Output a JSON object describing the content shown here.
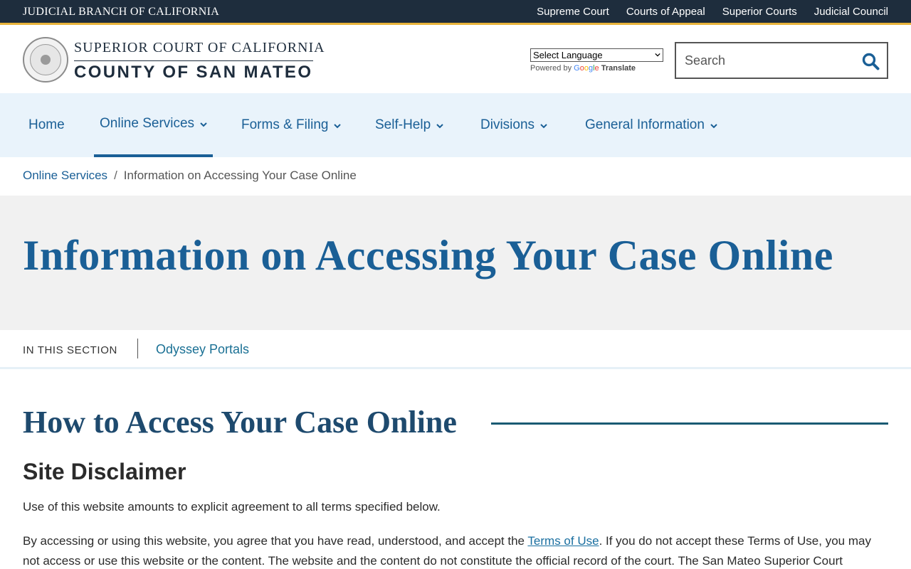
{
  "util_bar": {
    "brand": "JUDICIAL BRANCH OF CALIFORNIA",
    "links": [
      "Supreme Court",
      "Courts of Appeal",
      "Superior Courts",
      "Judicial Council"
    ]
  },
  "header": {
    "logo_line1": "SUPERIOR COURT OF CALIFORNIA",
    "logo_line2": "COUNTY OF SAN MATEO",
    "language_select": "Select Language",
    "powered_by": "Powered by",
    "google": [
      "G",
      "o",
      "o",
      "g",
      "l",
      "e"
    ],
    "translate": "Translate",
    "search_placeholder": "Search"
  },
  "nav": {
    "items": [
      {
        "label": "Home"
      },
      {
        "label": "Online Services"
      },
      {
        "label": "Forms & Filing"
      },
      {
        "label": "Self-Help"
      },
      {
        "label": "Divisions"
      },
      {
        "label": "General Information"
      }
    ]
  },
  "breadcrumb": {
    "parent": "Online Services",
    "separator": "/",
    "current": "Information on Accessing Your Case Online"
  },
  "hero": {
    "title": "Information on Accessing Your Case Online"
  },
  "section": {
    "label": "IN THIS SECTION",
    "link": "Odyssey Portals"
  },
  "content": {
    "heading": "How to Access Your Case Online",
    "subheading": "Site Disclaimer",
    "para1": "Use of this website amounts to explicit agreement to all terms specified below.",
    "para2_before": "By accessing or using this website, you agree that you have read, understood, and accept the ",
    "para2_link": "Terms of Use",
    "para2_after": ".  If you do not accept these Terms of Use, you may not access or use this website or the content. The website and the content do not constitute the official record of the court. The San Mateo Superior Court maintains"
  },
  "colors": {
    "utility_bar": "#1e2d3d",
    "accent_gold": "#e8b33a",
    "link_blue": "#1a5f96",
    "nav_bg": "#e9f3fb",
    "hero_bg": "#f1f1f1"
  }
}
